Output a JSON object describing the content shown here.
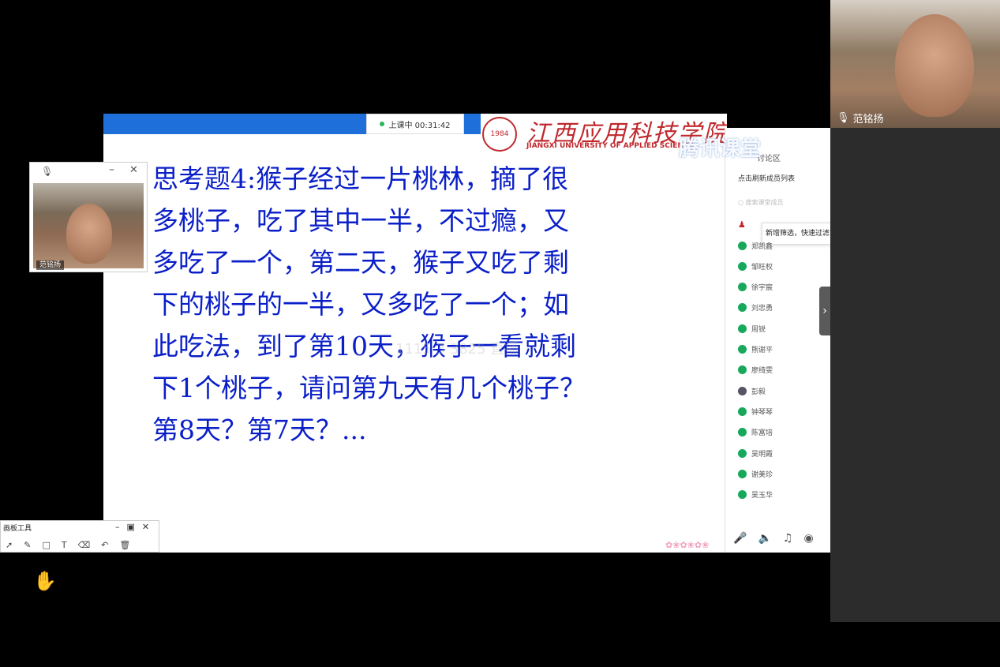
{
  "slide": {
    "timer": "上课中 00:31:42",
    "university_name_cn": "江西应用科技学院",
    "university_name_en": "JIANGXI UNIVERSITY OF APPLIED SCIENCE",
    "seal_text": "1984",
    "question_lines": [
      "思考题4:猴子经过一片桃林，摘了很",
      "多桃子，吃了其中一半，不过瘾，又",
      "多吃了一个，第二天，猴子又吃了剩",
      "下的桃子的一半，又多吃了一个；如",
      "此吃法，到了第10天，猴子一看就剩",
      "下1个桃子，请问第九天有几个桃子？",
      "第8天？第7天？..."
    ],
    "watermark": "1115 3 3825 直播"
  },
  "small_cam": {
    "name": "范铭扬"
  },
  "big_cam": {
    "name": "范铭扬"
  },
  "brand_overlay": "腾讯课堂",
  "panel": {
    "title": "讨论区",
    "refresh_label": "点击刷新成员列表",
    "search_placeholder": "搜索课堂成员",
    "tooltip": "新增筛选，快速过滤",
    "members": [
      "郑凯鑫",
      "邹旺权",
      "徐宇宸",
      "刘忠勇",
      "周锐",
      "熊谢平",
      "廖绮雯",
      "彭毅",
      "钟琴琴",
      "陈富培",
      "吴明霞",
      "谢美珍",
      "吴玉华"
    ],
    "collapse_label": "›"
  },
  "toolbox": {
    "title": "画板工具"
  },
  "colors": {
    "slide_text": "#0a1fc8",
    "brand_red": "#c0282d",
    "online_green": "#18a85b"
  }
}
